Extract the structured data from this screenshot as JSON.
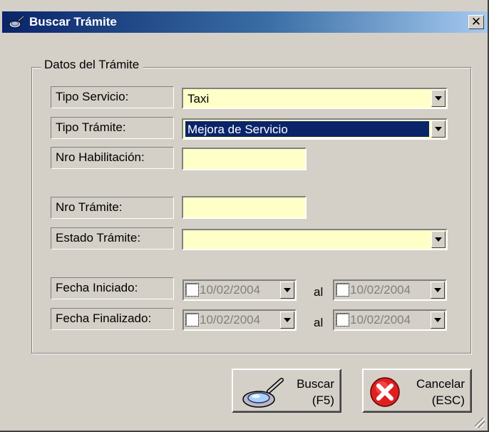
{
  "window": {
    "title": "Buscar Trámite",
    "close_label": "✕"
  },
  "group": {
    "legend": "Datos del Trámite"
  },
  "fields": {
    "tipo_servicio": {
      "label": "Tipo Servicio:",
      "value": "Taxi"
    },
    "tipo_tramite": {
      "label": "Tipo Trámite:",
      "value": "Mejora de Servicio"
    },
    "nro_habilitacion": {
      "label": "Nro Habilitación:",
      "value": ""
    },
    "nro_tramite": {
      "label": "Nro Trámite:",
      "value": ""
    },
    "estado_tramite": {
      "label": "Estado Trámite:",
      "value": ""
    },
    "fecha_iniciado": {
      "label": "Fecha Iniciado:",
      "from": "10/02/2004",
      "to": "10/02/2004"
    },
    "fecha_finalizado": {
      "label": "Fecha Finalizado:",
      "from": "10/02/2004",
      "to": "10/02/2004"
    },
    "range_separator": "al"
  },
  "buttons": {
    "buscar": "Buscar\n(F5)",
    "cancelar": "Cancelar\n(ESC)"
  },
  "colors": {
    "field_background": "#ffffc8",
    "selection": "#0a246a",
    "window_face": "#d4d0c8"
  },
  "icons": {
    "app": "search-app-icon",
    "buscar": "magnifier-icon",
    "cancelar": "red-x-icon"
  }
}
